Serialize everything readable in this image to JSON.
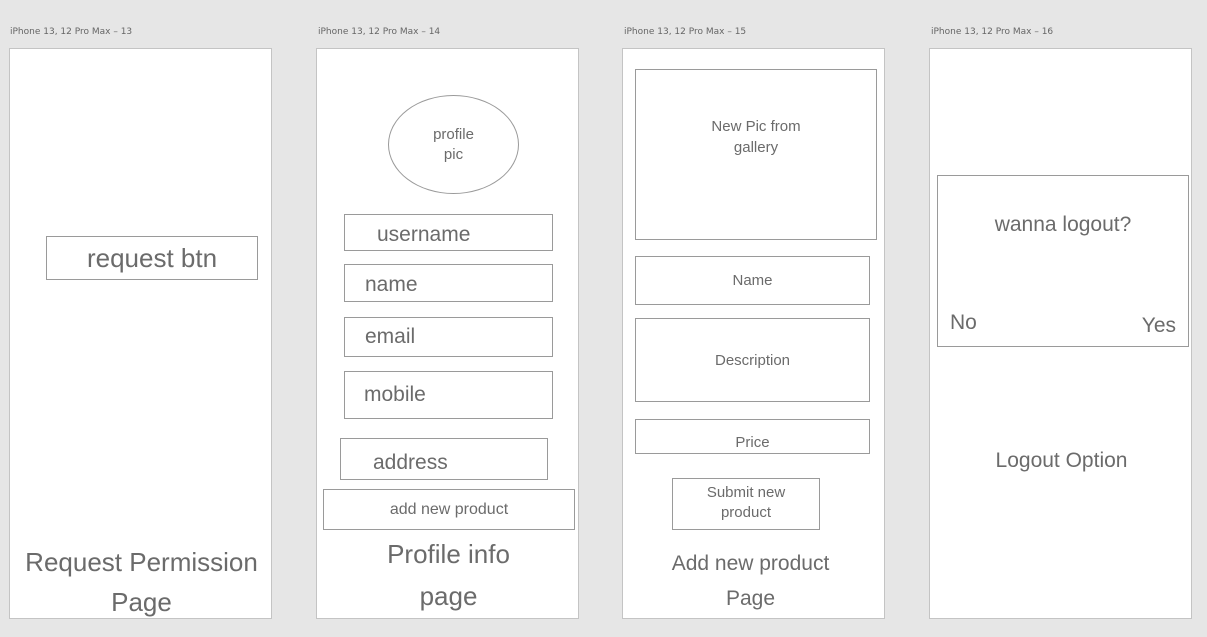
{
  "artboards": [
    {
      "title": "iPhone 13, 12 Pro Max – 13"
    },
    {
      "title": "iPhone 13, 12 Pro Max – 14"
    },
    {
      "title": "iPhone 13, 12 Pro Max – 15"
    },
    {
      "title": "iPhone 13, 12 Pro Max – 16"
    }
  ],
  "request_page": {
    "button": "request btn",
    "caption_line1": "Request Permission",
    "caption_line2": "Page"
  },
  "profile_page": {
    "profile_pic_line1": "profile",
    "profile_pic_line2": "pic",
    "fields": [
      "username",
      "name",
      "email",
      "mobile",
      "address"
    ],
    "add_product": "add new product",
    "caption_line1": "Profile info",
    "caption_line2": "page"
  },
  "add_product_page": {
    "pic_line1": "New Pic from",
    "pic_line2": "gallery",
    "name": "Name",
    "description": "Description",
    "price": "Price",
    "submit_line1": "Submit new",
    "submit_line2": "product",
    "caption_line1": "Add new product",
    "caption_line2": "Page"
  },
  "logout_page": {
    "question": "wanna logout?",
    "no": "No",
    "yes": "Yes",
    "caption": "Logout Option"
  }
}
